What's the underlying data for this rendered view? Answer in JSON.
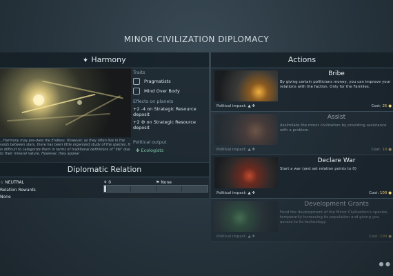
{
  "screen_title": "MINOR CIVILIZATION DIPLOMACY",
  "faction": {
    "name": "Harmony",
    "icon": "harmony-leaf-icon",
    "description": "...Harmony may pre-date the Endless. However, as they often live in the voids between stars, there has been little organized study of the species. It is difficult to categorize them in terms of traditional definitions of \"life\" due to their mineral nature. However, they appear",
    "traits_label": "Traits",
    "traits": [
      {
        "icon": "pragmatists-icon",
        "label": "Pragmatists"
      },
      {
        "icon": "mind-over-body-icon",
        "label": "Mind Over Body"
      }
    ],
    "effects_label": "Effects on planets",
    "effects": [
      "+2 -4 on Strategic Resource deposit",
      "+2 ⚙ on Strategic Resource deposit"
    ],
    "political_output_label": "Political output",
    "political_output_value": "✤ Ecologists"
  },
  "diplomatic_relation": {
    "title": "Diplomatic Relation",
    "status": "NEUTRAL",
    "rewards_label": "Relation Rewards",
    "rewards_value": "None",
    "relation_points": "0",
    "war_status": "None"
  },
  "actions_title": "Actions",
  "actions": [
    {
      "name": "Bribe",
      "description": "By giving certain politicians money, you can improve your relations with the faction. Only for the Families.",
      "impact_label": "Political impact:",
      "impact_icons": "▲ ✤",
      "cost_label": "Cost:",
      "cost_value": "25",
      "cost_icon": "dust-coin-icon"
    },
    {
      "name": "Assist",
      "description": "Assimilate the minor civilization by providing assistance with a problem.",
      "impact_label": "Political impact:",
      "impact_icons": "▲ ✤",
      "cost_label": "Cost:",
      "cost_value": "10",
      "cost_icon": "dust-coin-icon"
    },
    {
      "name": "Declare War",
      "description": "Start a war (and set relation points to 0)",
      "impact_label": "Political impact:",
      "impact_icons": "▲ ✤",
      "cost_label": "Cost:",
      "cost_value": "100",
      "cost_icon": "dust-coin-icon"
    },
    {
      "name": "Development Grants",
      "description": "Fund the development of the Minor Civilization's species, temporarily increasing its population and giving you access to its technology.",
      "impact_label": "Political impact:",
      "impact_icons": "▲ ✤",
      "cost_label": "Cost:",
      "cost_value": "100",
      "cost_icon": "dust-coin-icon"
    }
  ],
  "colors": {
    "accent_gold": "#f0d070",
    "ecologist_green": "#7fc7a8",
    "panel_bg": "#18222a"
  }
}
